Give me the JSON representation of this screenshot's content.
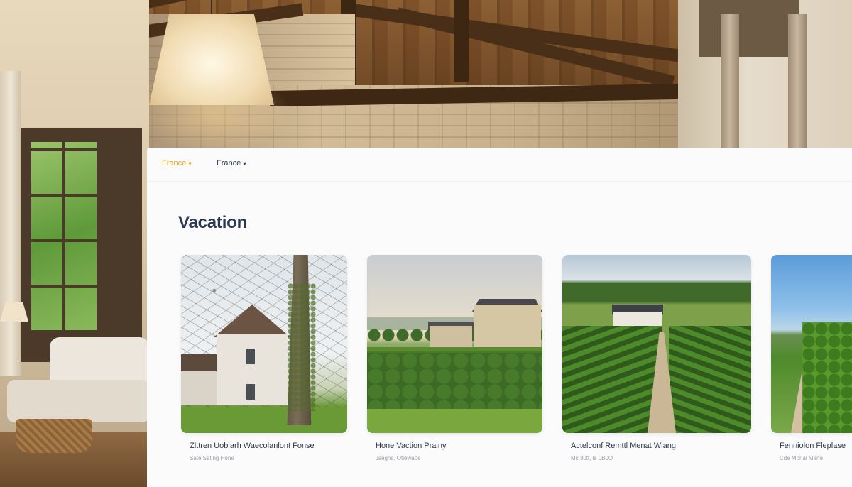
{
  "topnav": {
    "items": [
      {
        "label": "France",
        "chevron": "♥",
        "color": "#e8a31a",
        "active": true
      },
      {
        "label": "France",
        "chevron": "♥",
        "color": "#2c3a55",
        "active": false
      }
    ]
  },
  "section": {
    "title": "Vacation"
  },
  "cards": [
    {
      "name": "Zlttren Uoblarh Waecolanlont Fonse",
      "sub": "Sate Satlng Hone"
    },
    {
      "name": "Hone Vaction Prainy",
      "sub": "Jsegns, Otlewaoe"
    },
    {
      "name": "Actelconf Remttl Menat Wiang",
      "sub": "Mc 30tt, is LB0O"
    },
    {
      "name": "Fenniolon Fleplase",
      "sub": "Cde Morlal Mane"
    }
  ],
  "colors": {
    "accent": "#e8a31a",
    "title": "#2b3852",
    "panel_bg": "#fbfbfc"
  }
}
